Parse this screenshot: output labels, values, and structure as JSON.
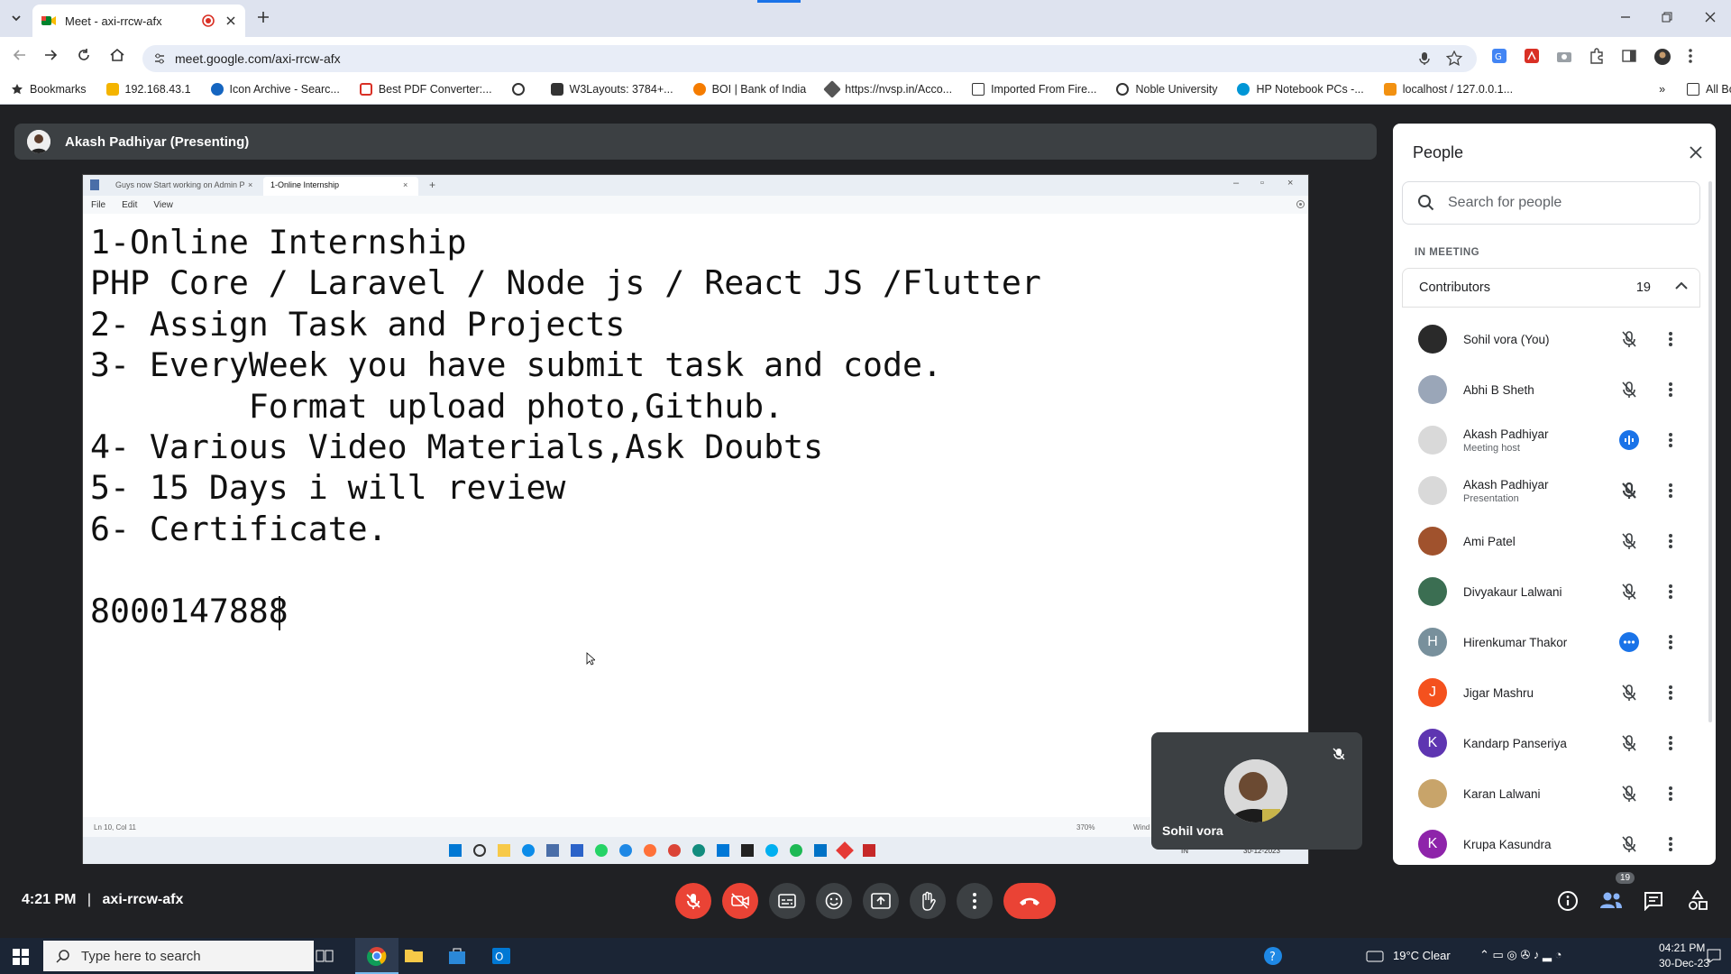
{
  "browser": {
    "tab_title": "Meet - axi-rrcw-afx",
    "url": "meet.google.com/axi-rrcw-afx",
    "bookmarks": [
      "Bookmarks",
      "192.168.43.1",
      "Icon Archive - Searc...",
      "Best PDF Converter:...",
      "W3Layouts: 3784+...",
      "BOI | Bank of India",
      "https://nvsp.in/Acco...",
      "Imported From Fire...",
      "Noble University",
      "HP Notebook PCs -...",
      "localhost / 127.0.0.1..."
    ],
    "all_bookmarks": "All Bookmarks"
  },
  "meet": {
    "presenter_label": "Akash Padhiyar (Presenting)",
    "meeting_time": "4:21 PM",
    "meeting_code": "axi-rrcw-afx",
    "people_badge": "19",
    "self_view_name": "Sohil vora"
  },
  "shared_screen": {
    "tabs": [
      "Guys now Start working on Admin P",
      "1-Online Internship"
    ],
    "menu": [
      "File",
      "Edit",
      "View"
    ],
    "text": "1-Online Internship\nPHP Core / Laravel / Node js / React JS /Flutter\n2- Assign Task and Projects\n3- EveryWeek you have submit task and code.\n        Format upload photo,Github.\n4- Various Video Materials,Ask Doubts\n5- 15 Days i will review\n6- Certificate.\n\n8000147888",
    "status_pos": "Ln 10, Col 11",
    "status_zoom": "370%",
    "status_encoding": "Wind",
    "clock_lang": "IN",
    "clock_date": "30-12-2023"
  },
  "people_panel": {
    "title": "People",
    "search_placeholder": "Search for people",
    "section": "IN MEETING",
    "group_label": "Contributors",
    "group_count": "19",
    "participants": [
      {
        "name": "Sohil vora (You)",
        "sub": "",
        "initial": "",
        "color": "#2a2a2a",
        "mic": "muted"
      },
      {
        "name": "Abhi B Sheth",
        "sub": "",
        "initial": "",
        "color": "#9aa6b8",
        "mic": "muted"
      },
      {
        "name": "Akash Padhiyar",
        "sub": "Meeting host",
        "initial": "",
        "color": "#d9d9d9",
        "mic": "speaking"
      },
      {
        "name": "Akash Padhiyar",
        "sub": "Presentation",
        "initial": "",
        "color": "#d9d9d9",
        "mic": "muted-strong"
      },
      {
        "name": "Ami Patel",
        "sub": "",
        "initial": "",
        "color": "#a0522d",
        "mic": "muted"
      },
      {
        "name": "Divyakaur Lalwani",
        "sub": "",
        "initial": "",
        "color": "#3b6e52",
        "mic": "muted"
      },
      {
        "name": "Hirenkumar Thakor",
        "sub": "",
        "initial": "H",
        "color": "#78909c",
        "mic": "active"
      },
      {
        "name": "Jigar Mashru",
        "sub": "",
        "initial": "J",
        "color": "#f4511e",
        "mic": "muted"
      },
      {
        "name": "Kandarp Panseriya",
        "sub": "",
        "initial": "K",
        "color": "#5e35b1",
        "mic": "muted"
      },
      {
        "name": "Karan Lalwani",
        "sub": "",
        "initial": "",
        "color": "#c8a46a",
        "mic": "muted"
      },
      {
        "name": "Krupa Kasundra",
        "sub": "",
        "initial": "K",
        "color": "#8e24aa",
        "mic": "muted"
      }
    ]
  },
  "windows": {
    "search_placeholder": "Type here to search",
    "weather": "19°C  Clear",
    "time": "04:21 PM",
    "date": "30-Dec-23"
  },
  "colors": {
    "accent_blue": "#1a73e8",
    "end_red": "#ea4335",
    "panel_bg": "#ffffff",
    "meet_bg": "#202124"
  }
}
